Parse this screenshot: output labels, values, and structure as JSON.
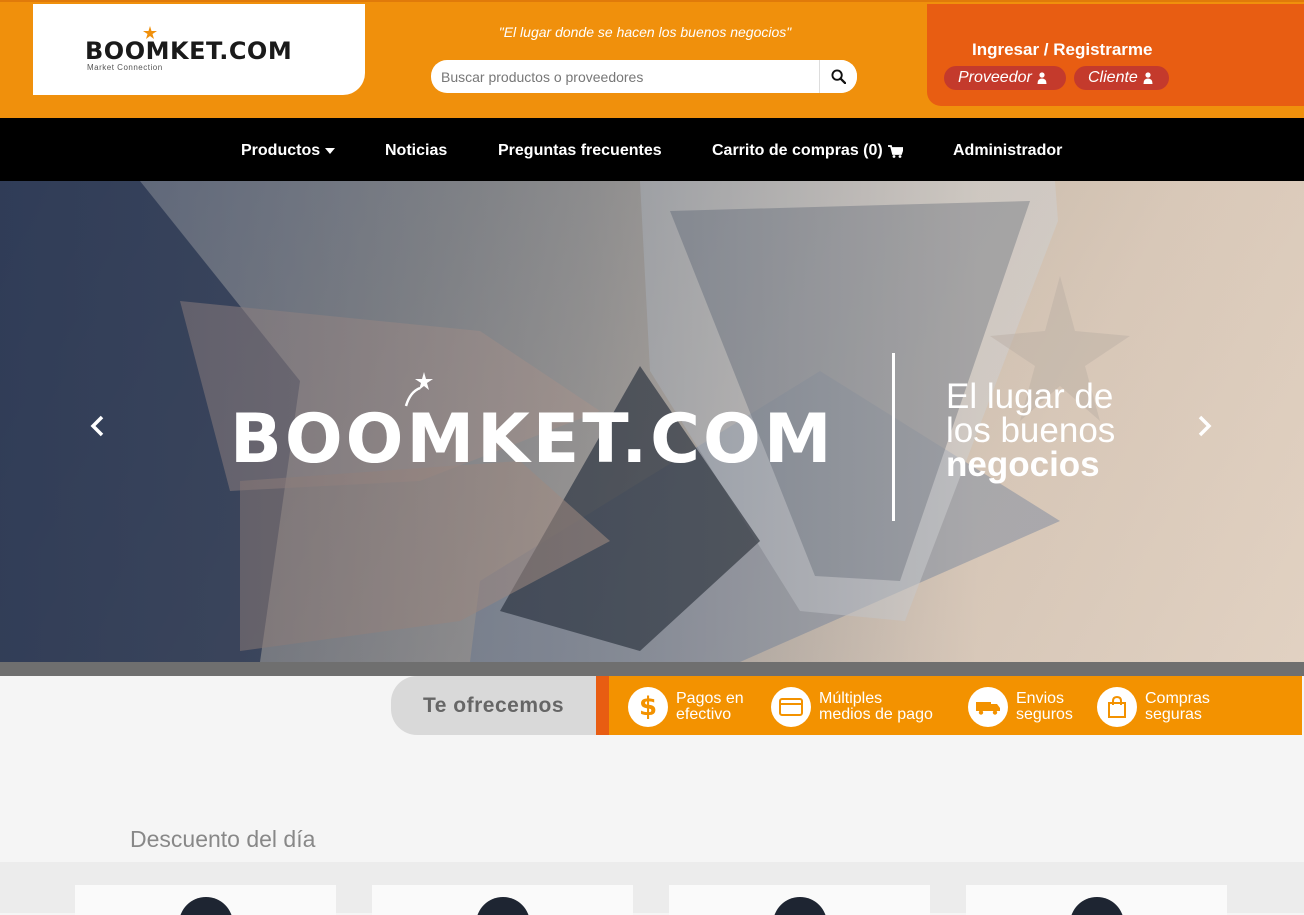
{
  "header": {
    "logo_text": "BOOMKET.COM",
    "logo_subtitle": "Market Connection",
    "slogan": "\"El lugar donde se hacen los buenos negocios\"",
    "search": {
      "placeholder": "Buscar productos o proveedores",
      "value": "",
      "icon": "search-icon"
    },
    "auth": {
      "title": "Ingresar / Registrarme",
      "proveedor_label": "Proveedor",
      "cliente_label": "Cliente",
      "icon": "user-icon"
    }
  },
  "nav": {
    "items": [
      {
        "label": "Productos",
        "icon": "caret-down-icon"
      },
      {
        "label": "Noticias"
      },
      {
        "label": "Preguntas frecuentes"
      },
      {
        "label": "Carrito de compras (0)",
        "icon": "cart-icon"
      },
      {
        "label": "Administrador"
      }
    ]
  },
  "hero": {
    "brand": "BOOMKET.COM",
    "tagline_line1": "El lugar de",
    "tagline_line2": "los buenos",
    "tagline_line3": "negocios",
    "prev_icon": "chevron-left-icon",
    "next_icon": "chevron-right-icon"
  },
  "offers": {
    "label": "Te ofrecemos",
    "items": [
      {
        "line1": "Pagos en",
        "line2": "efectivo",
        "icon": "dollar-icon"
      },
      {
        "line1": "Múltiples",
        "line2": "medios de pago",
        "icon": "card-icon"
      },
      {
        "line1": "Envios",
        "line2": "seguros",
        "icon": "truck-icon"
      },
      {
        "line1": "Compras",
        "line2": "seguras",
        "icon": "shopping-bag-icon"
      }
    ]
  },
  "section": {
    "title": "Descuento del día"
  },
  "colors": {
    "orange": "#f0900c",
    "dark_orange": "#e85d12",
    "pill_red": "#c43a2c",
    "nav_black": "#000000"
  }
}
